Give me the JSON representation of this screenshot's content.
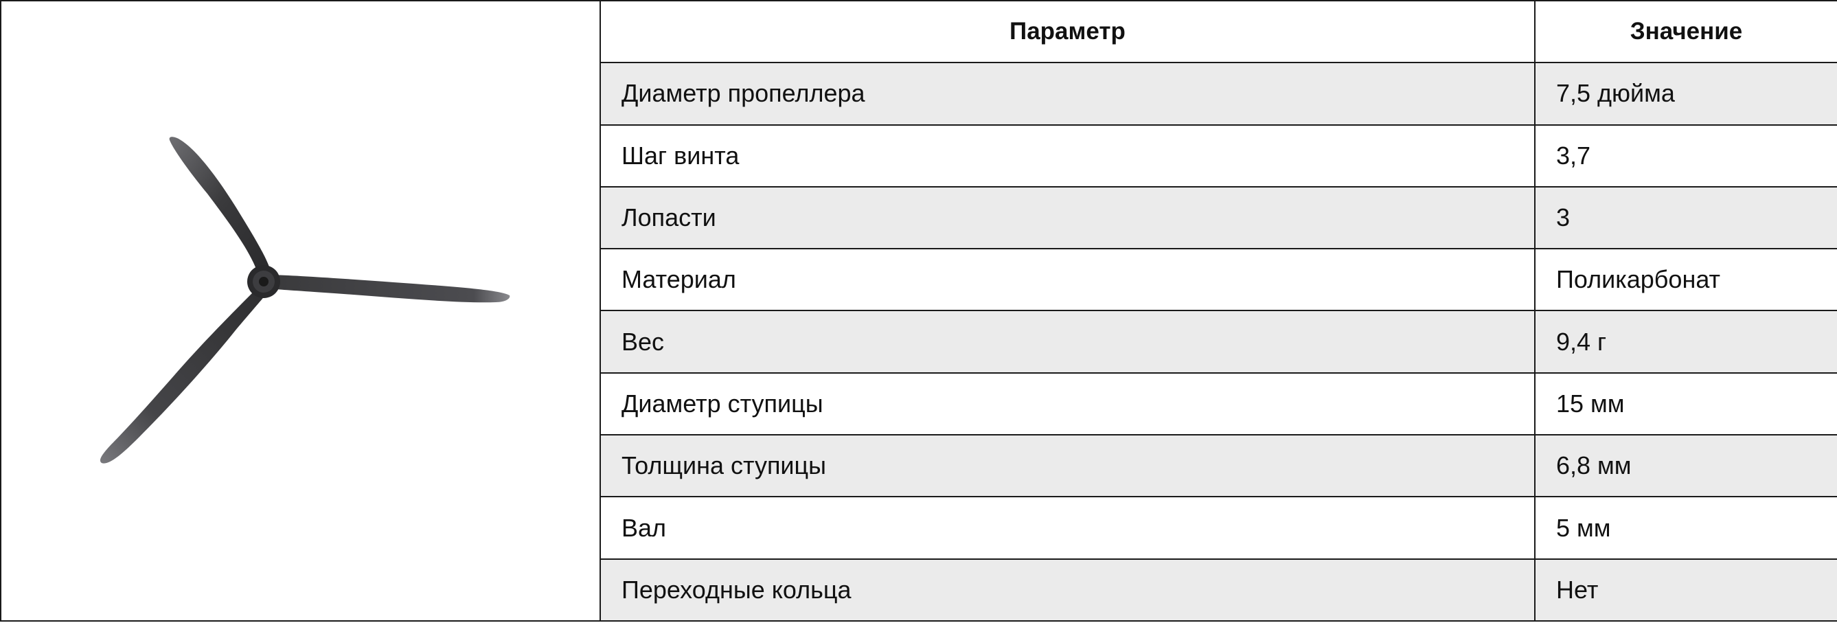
{
  "table": {
    "header": {
      "param": "Параметр",
      "value": "Значение"
    },
    "rows": [
      {
        "param": "Диаметр пропеллера",
        "value": "7,5 дюйма"
      },
      {
        "param": "Шаг винта",
        "value": "3,7"
      },
      {
        "param": "Лопасти",
        "value": "3"
      },
      {
        "param": "Материал",
        "value": "Поликарбонат"
      },
      {
        "param": "Вес",
        "value": "9,4 г"
      },
      {
        "param": "Диаметр ступицы",
        "value": "15 мм"
      },
      {
        "param": "Толщина ступицы",
        "value": "6,8 мм"
      },
      {
        "param": "Вал",
        "value": "5 мм"
      },
      {
        "param": "Переходные кольца",
        "value": "Нет"
      }
    ]
  },
  "image": {
    "subject": "three-blade-propeller",
    "blade_color": "#3a3a3c"
  },
  "colors": {
    "border": "#1a1a1a",
    "shaded_row": "#ebebeb",
    "plain_row": "#ffffff",
    "text": "#111111"
  }
}
